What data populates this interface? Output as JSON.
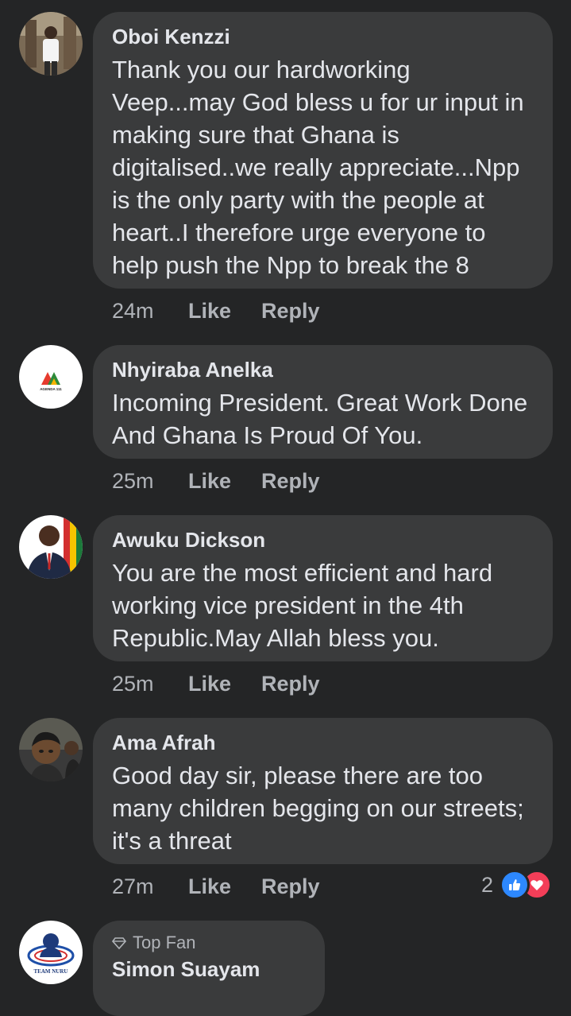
{
  "comments": [
    {
      "author": "Oboi Kenzzi",
      "text": "Thank you our hardworking Veep...may God bless u for ur input in making sure that Ghana is digitalised..we really appreciate...Npp is the only party with the people at heart..I therefore urge everyone to help push the Npp to break the 8",
      "time": "24m",
      "like_label": "Like",
      "reply_label": "Reply"
    },
    {
      "author": "Nhyiraba Anelka",
      "text": "Incoming President. Great Work Done And Ghana Is Proud Of You.",
      "time": "25m",
      "like_label": "Like",
      "reply_label": "Reply",
      "avatar_text": "AGENDA 111"
    },
    {
      "author": "Awuku Dickson",
      "text": "You are the most efficient and hard working vice president in the 4th Republic.May Allah bless you.",
      "time": "25m",
      "like_label": "Like",
      "reply_label": "Reply"
    },
    {
      "author": "Ama Afrah",
      "text": "Good day sir, please there are too many children begging on our streets; it's a threat",
      "time": "27m",
      "like_label": "Like",
      "reply_label": "Reply",
      "reactions": {
        "count": "2",
        "icons": [
          "like-icon",
          "love-icon"
        ]
      }
    },
    {
      "author": "Simon Suayam",
      "badge": "Top Fan",
      "badge_icon": "diamond-icon",
      "avatar_text": "TEAM NURU"
    }
  ],
  "colors": {
    "background": "#242526",
    "bubble": "#3a3b3c",
    "text": "#e4e6eb",
    "secondary": "#b0b3b8",
    "like_blue": "#2d88ff",
    "love_red": "#f33e58"
  }
}
